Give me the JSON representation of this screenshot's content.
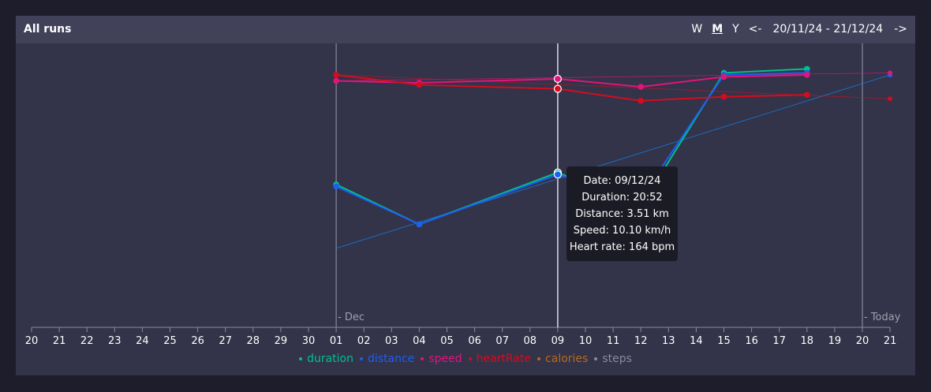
{
  "header": {
    "title": "All runs",
    "range_week": "W",
    "range_month": "M",
    "range_year": "Y",
    "prev": "<-",
    "date_range": "20/11/24 - 21/12/24",
    "next": "->"
  },
  "chart_data": {
    "type": "line",
    "x_tick_labels": [
      "20",
      "21",
      "22",
      "23",
      "24",
      "25",
      "26",
      "27",
      "28",
      "29",
      "30",
      "01",
      "02",
      "03",
      "04",
      "05",
      "06",
      "07",
      "08",
      "09",
      "10",
      "11",
      "12",
      "13",
      "14",
      "15",
      "16",
      "17",
      "18",
      "19",
      "20",
      "21"
    ],
    "markers": [
      {
        "label": "Dec",
        "index": 11
      },
      {
        "label": "Today",
        "index": 30
      }
    ],
    "hover_index": 19,
    "series": [
      {
        "name": "duration",
        "color": "#00c08b",
        "x_index": [
          11,
          14,
          19,
          22,
          25,
          28
        ],
        "rel": [
          0.42,
          0.22,
          0.48,
          0.31,
          0.98,
          1.0
        ]
      },
      {
        "name": "distance",
        "color": "#1e5ef0",
        "x_index": [
          11,
          14,
          19,
          22,
          25,
          28
        ],
        "rel": [
          0.41,
          0.22,
          0.47,
          0.35,
          0.97,
          0.98
        ]
      },
      {
        "name": "speed",
        "color": "#e0157a",
        "x_index": [
          11,
          14,
          19,
          22,
          25,
          28
        ],
        "rel": [
          0.94,
          0.93,
          0.95,
          0.91,
          0.96,
          0.97
        ]
      },
      {
        "name": "heartRate",
        "color": "#d30d1f",
        "x_index": [
          11,
          14,
          19,
          22,
          25,
          28
        ],
        "rel": [
          0.97,
          0.92,
          0.9,
          0.84,
          0.86,
          0.87
        ]
      },
      {
        "name": "calories",
        "color": "#b36a1e",
        "x_index": [],
        "rel": []
      },
      {
        "name": "steps",
        "color": "#8a8a9a",
        "x_index": [],
        "rel": []
      }
    ],
    "trend_right": [
      {
        "name": "duration",
        "rel": 0.97
      },
      {
        "name": "distance",
        "rel": 0.97
      },
      {
        "name": "speed",
        "rel": 0.98
      },
      {
        "name": "heartRate",
        "rel": 0.85
      }
    ]
  },
  "tooltip": {
    "date": "Date: 09/12/24",
    "duration": "Duration: 20:52",
    "distance": "Distance: 3.51 km",
    "speed": "Speed: 10.10 km/h",
    "heart_rate": "Heart rate: 164 bpm"
  },
  "legend": [
    {
      "label": "duration",
      "color": "#00c08b"
    },
    {
      "label": "distance",
      "color": "#1e5ef0"
    },
    {
      "label": "speed",
      "color": "#e0157a"
    },
    {
      "label": "heartRate",
      "color": "#d30d1f"
    },
    {
      "label": "calories",
      "color": "#b36a1e"
    },
    {
      "label": "steps",
      "color": "#8a8a9a"
    }
  ]
}
